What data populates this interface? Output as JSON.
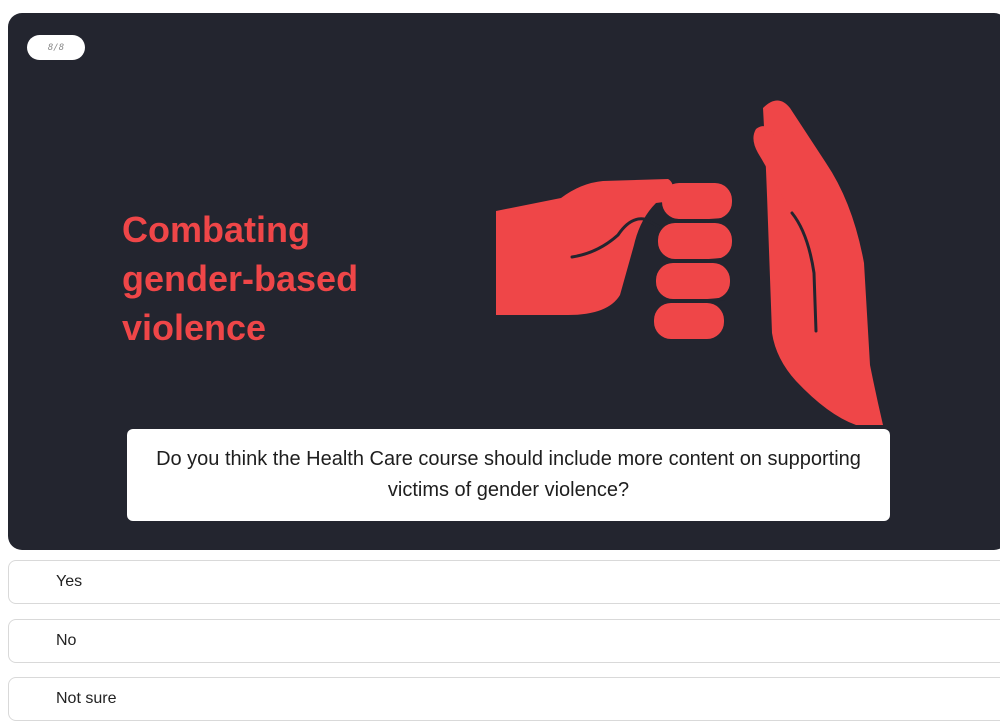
{
  "slide": {
    "counter": "8/8",
    "title": "Combating\ngender-based\nviolence",
    "accent_color": "#ef4648",
    "background_color": "#23252f",
    "illustration": "fist-hitting-open-hand-icon"
  },
  "question": {
    "text": "Do you think the Health Care course should include more content on supporting victims of gender violence?"
  },
  "options": [
    {
      "label": "Yes"
    },
    {
      "label": "No"
    },
    {
      "label": "Not sure"
    }
  ]
}
